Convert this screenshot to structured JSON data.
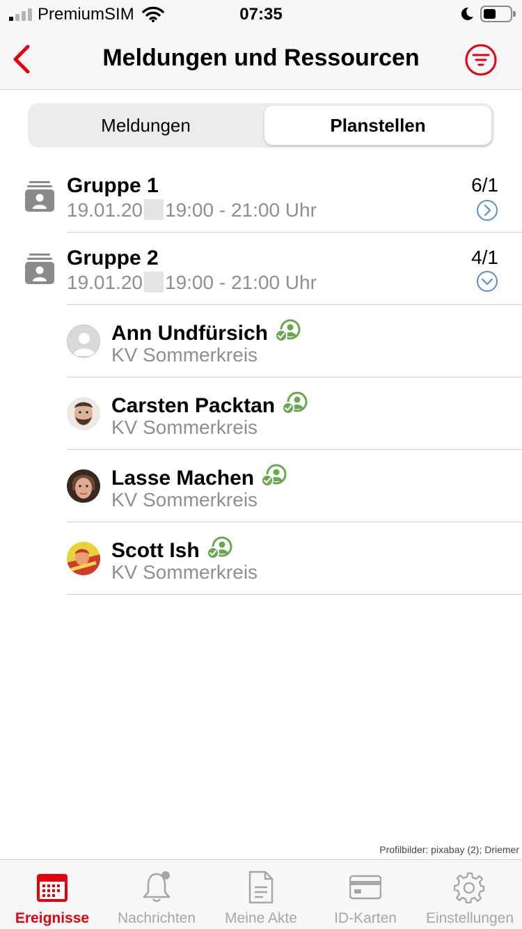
{
  "status_bar": {
    "carrier": "PremiumSIM",
    "time": "07:35",
    "icons": [
      "signal-icon",
      "wifi-icon",
      "moon-icon",
      "battery-icon"
    ]
  },
  "nav": {
    "title": "Meldungen und Ressourcen",
    "back_icon": "chevron-left-icon",
    "filter_icon": "filter-icon"
  },
  "segments": {
    "items": [
      "Meldungen",
      "Planstellen"
    ],
    "selected": "Planstellen"
  },
  "groups": [
    {
      "title": "Gruppe 1",
      "date_prefix": "19.01.20",
      "time": "19:00 - 21:00 Uhr",
      "count": "6/1",
      "expanded": false
    },
    {
      "title": "Gruppe 2",
      "date_prefix": "19.01.20",
      "time": "19:00 - 21:00 Uhr",
      "count": "4/1",
      "expanded": true
    }
  ],
  "people": [
    {
      "name": "Ann Undfürsich",
      "org": "KV Sommerkreis",
      "avatar": "placeholder"
    },
    {
      "name": "Carsten Packtan",
      "org": "KV Sommerkreis",
      "avatar": "photo"
    },
    {
      "name": "Lasse Machen",
      "org": "KV Sommerkreis",
      "avatar": "photo"
    },
    {
      "name": "Scott Ish",
      "org": "KV Sommerkreis",
      "avatar": "photo"
    }
  ],
  "credits": "Profilbilder: pixabay (2); Driemer",
  "tabs": [
    {
      "label": "Ereignisse",
      "icon": "calendar-icon",
      "active": true
    },
    {
      "label": "Nachrichten",
      "icon": "bell-icon",
      "active": false
    },
    {
      "label": "Meine Akte",
      "icon": "document-icon",
      "active": false
    },
    {
      "label": "ID-Karten",
      "icon": "id-card-icon",
      "active": false
    },
    {
      "label": "Einstellungen",
      "icon": "gear-icon",
      "active": false
    }
  ],
  "colors": {
    "accent": "#e3000f",
    "secondary_text": "#8e8e93",
    "chevron": "#5b8fc7",
    "status_ok": "#6aa84f",
    "tab_inactive": "#a6a6a6"
  }
}
